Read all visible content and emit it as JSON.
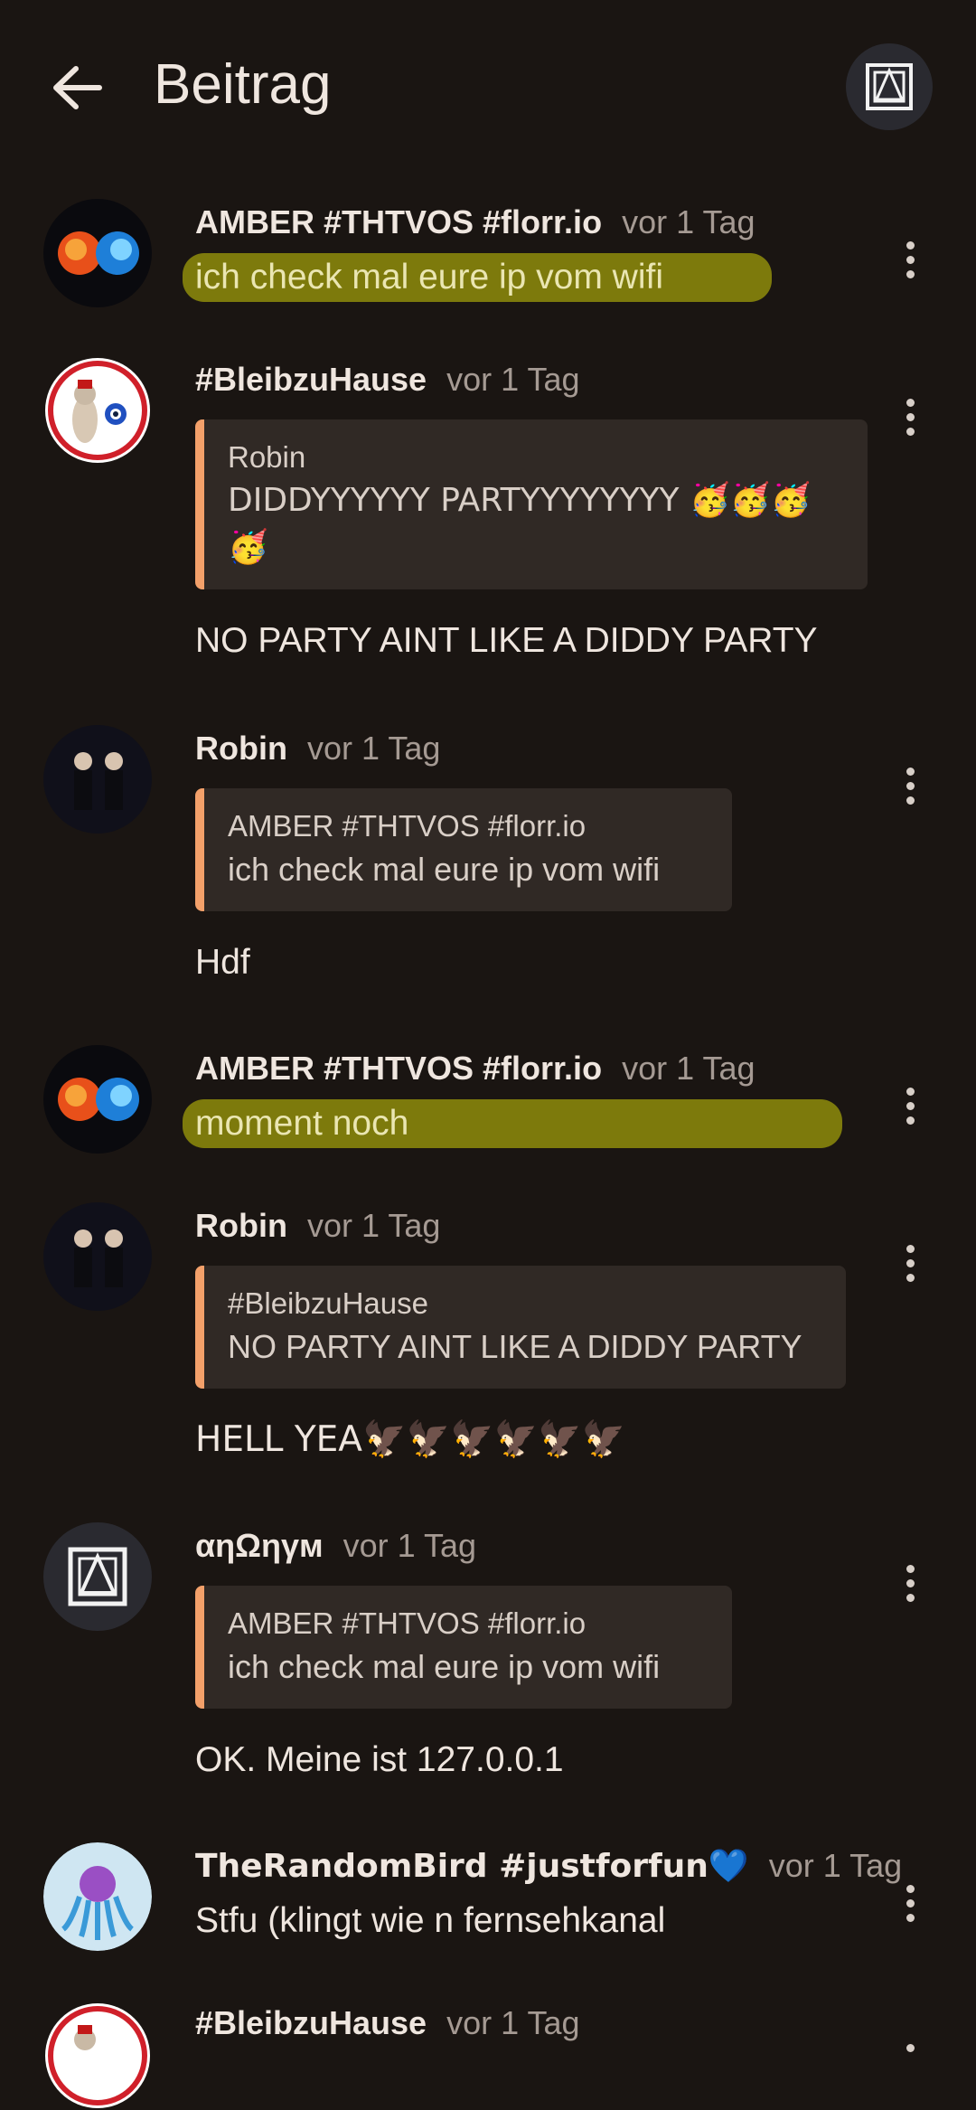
{
  "header": {
    "title": "Beitrag"
  },
  "posts": [
    {
      "author": "AMBER #THTVOS #florr.io",
      "time": "vor 1 Tag",
      "text": "ich check mal eure ip vom wifi"
    },
    {
      "author": "#BleibzuHause",
      "time": "vor 1 Tag",
      "quote": {
        "author": "Robin",
        "text": "DIDDYYYYYY PARTYYYYYYYY 🥳🥳🥳🥳"
      },
      "text": "NO PARTY AINT LIKE A DIDDY PARTY"
    },
    {
      "author": "Robin",
      "time": "vor 1 Tag",
      "quote": {
        "author": "AMBER #THTVOS #florr.io",
        "text": "ich check mal eure ip vom wifi"
      },
      "text": "Hdf"
    },
    {
      "author": "AMBER #THTVOS #florr.io",
      "time": "vor 1 Tag",
      "text": "moment noch"
    },
    {
      "author": "Robin",
      "time": "vor 1 Tag",
      "quote": {
        "author": "#BleibzuHause",
        "text": "NO PARTY AINT LIKE A DIDDY PARTY"
      },
      "text": "HELL YEA🦅🦅🦅🦅🦅🦅"
    },
    {
      "author": "αηΩηγм",
      "time": "vor 1 Tag",
      "quote": {
        "author": "AMBER #THTVOS #florr.io",
        "text": "ich check mal eure ip vom wifi"
      },
      "text": "OK. Meine ist 127.0.0.1"
    },
    {
      "author": "TheRandomBird #justforfun💙",
      "time": "vor 1 Tag",
      "text": "Stfu (klingt wie n fernsehkanal"
    },
    {
      "author": "#BleibzuHause",
      "time": "vor 1 Tag"
    }
  ],
  "icons": {
    "back": "arrow-left-icon",
    "more": "more-vertical-icon"
  },
  "colors": {
    "background": "#1a1512",
    "quote_accent": "#f3a06a",
    "highlight": "#7d7a0c"
  }
}
